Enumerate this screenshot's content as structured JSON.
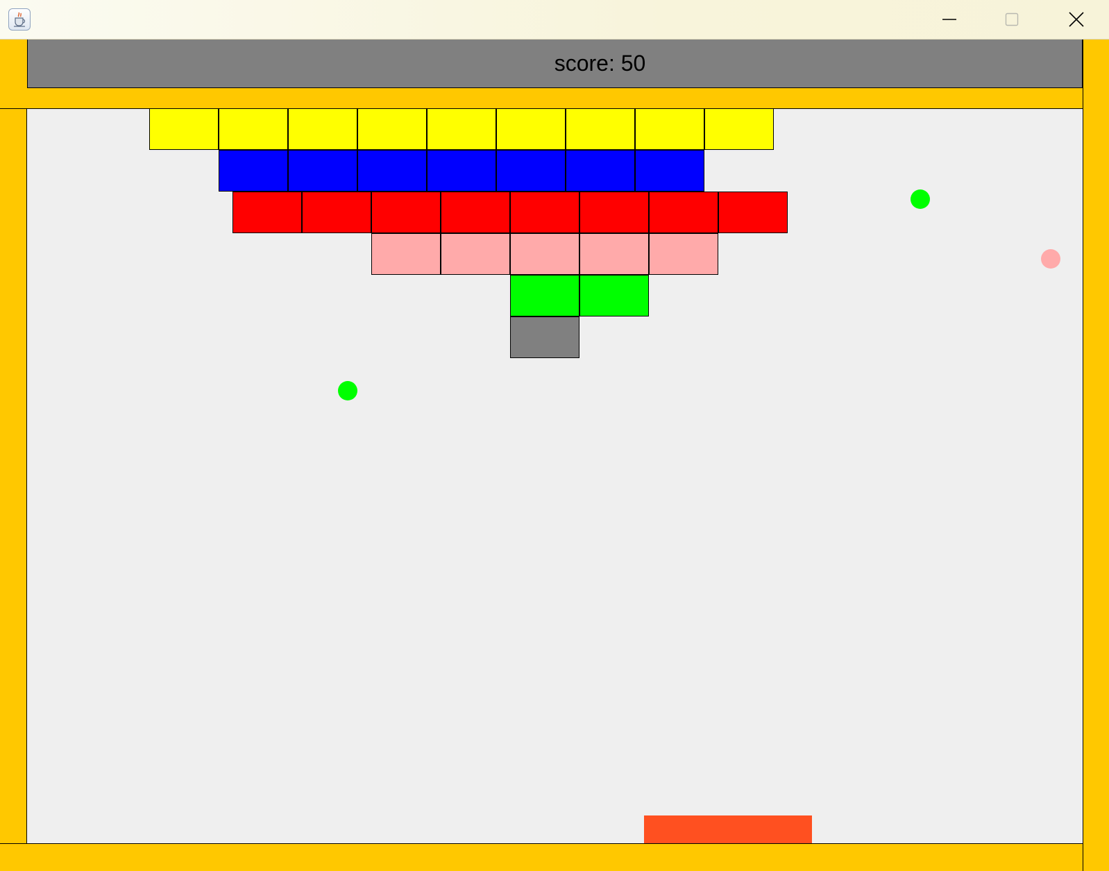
{
  "window": {
    "app_icon": "java-cup-icon",
    "buttons": {
      "minimize_icon": "minimize-icon",
      "maximize_icon": "maximize-icon",
      "close_icon": "close-icon"
    }
  },
  "score": {
    "text": "score: 50"
  },
  "colors": {
    "frame": "#ffc800",
    "score_panel": "#808080",
    "play_area": "#efefef",
    "paddle": "#ff5020",
    "yellow": "#ffff00",
    "blue": "#0000ff",
    "red": "#ff0000",
    "pink": "#ffaaaa",
    "green": "#00ff00",
    "gray": "#808080"
  },
  "bricks": [
    {
      "row": 0,
      "col": 0,
      "color": "yellow"
    },
    {
      "row": 0,
      "col": 1,
      "color": "yellow"
    },
    {
      "row": 0,
      "col": 2,
      "color": "yellow"
    },
    {
      "row": 0,
      "col": 3,
      "color": "yellow"
    },
    {
      "row": 0,
      "col": 4,
      "color": "yellow"
    },
    {
      "row": 0,
      "col": 5,
      "color": "yellow"
    },
    {
      "row": 0,
      "col": 6,
      "color": "yellow"
    },
    {
      "row": 0,
      "col": 7,
      "color": "yellow"
    },
    {
      "row": 0,
      "col": 8,
      "color": "yellow"
    },
    {
      "row": 1,
      "col": 1,
      "color": "blue"
    },
    {
      "row": 1,
      "col": 2,
      "color": "blue"
    },
    {
      "row": 1,
      "col": 3,
      "color": "blue"
    },
    {
      "row": 1,
      "col": 4,
      "color": "blue"
    },
    {
      "row": 1,
      "col": 5,
      "color": "blue"
    },
    {
      "row": 1,
      "col": 6,
      "color": "blue"
    },
    {
      "row": 1,
      "col": 7,
      "color": "blue"
    },
    {
      "row": 2,
      "col": 1.2,
      "color": "red"
    },
    {
      "row": 2,
      "col": 2.2,
      "color": "red"
    },
    {
      "row": 2,
      "col": 3.2,
      "color": "red"
    },
    {
      "row": 2,
      "col": 4.2,
      "color": "red"
    },
    {
      "row": 2,
      "col": 5.2,
      "color": "red"
    },
    {
      "row": 2,
      "col": 6.2,
      "color": "red"
    },
    {
      "row": 2,
      "col": 7.2,
      "color": "red"
    },
    {
      "row": 2,
      "col": 8.2,
      "color": "red"
    },
    {
      "row": 3,
      "col": 3.2,
      "color": "pink"
    },
    {
      "row": 3,
      "col": 4.2,
      "color": "pink"
    },
    {
      "row": 3,
      "col": 5.2,
      "color": "pink"
    },
    {
      "row": 3,
      "col": 6.2,
      "color": "pink"
    },
    {
      "row": 3,
      "col": 7.2,
      "color": "pink"
    },
    {
      "row": 4,
      "col": 5.2,
      "color": "green"
    },
    {
      "row": 4,
      "col": 6.2,
      "color": "green"
    },
    {
      "row": 5,
      "col": 5.2,
      "color": "gray"
    }
  ],
  "balls": [
    {
      "color": "green"
    },
    {
      "color": "pink"
    },
    {
      "color": "green"
    }
  ]
}
